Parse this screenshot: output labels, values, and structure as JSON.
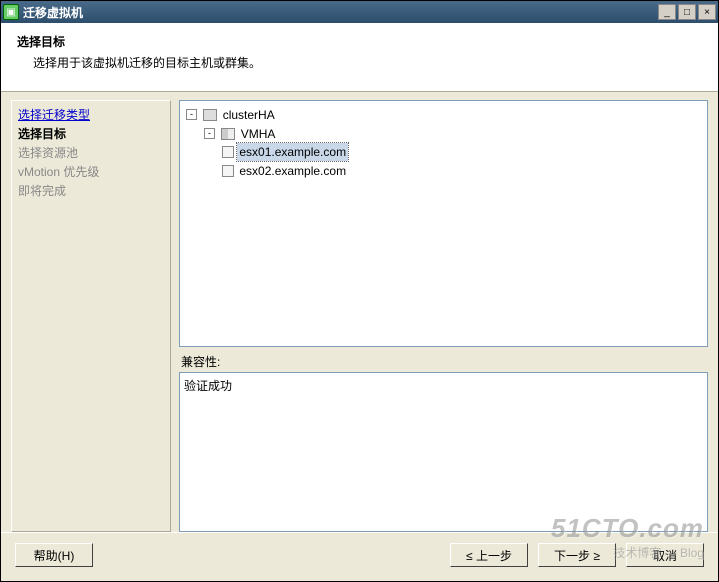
{
  "titlebar": {
    "title": "迁移虚拟机"
  },
  "header": {
    "title": "选择目标",
    "desc": "选择用于该虚拟机迁移的目标主机或群集。"
  },
  "sidebar": {
    "items": [
      {
        "label": "选择迁移类型",
        "kind": "link"
      },
      {
        "label": "选择目标",
        "kind": "bold"
      },
      {
        "label": "选择资源池",
        "kind": "dim"
      },
      {
        "label": "vMotion 优先级",
        "kind": "dim"
      },
      {
        "label": "即将完成",
        "kind": "dim"
      }
    ]
  },
  "tree": {
    "root": {
      "label": "clusterHA",
      "children": [
        {
          "label": "VMHA",
          "children": [
            {
              "label": "esx01.example.com",
              "selected": true
            },
            {
              "label": "esx02.example.com",
              "selected": false
            }
          ]
        }
      ]
    }
  },
  "compat": {
    "label": "兼容性:",
    "message": "验证成功"
  },
  "footer": {
    "help": "帮助(H)",
    "back": "≤ 上一步",
    "next": "下一步 ≥",
    "cancel": "取消"
  },
  "watermark": {
    "main": "51CTO.com",
    "sub": "技术博客 — Blog"
  }
}
